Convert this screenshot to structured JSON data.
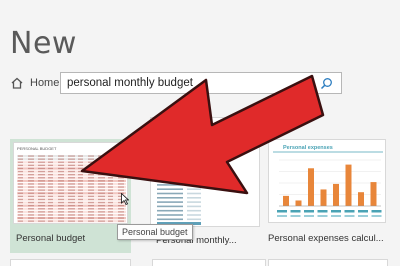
{
  "page": {
    "title": "New"
  },
  "nav": {
    "home_label": "Home",
    "search_value": "personal monthly budget",
    "home_icon": "home-icon",
    "search_icon": "search-icon"
  },
  "templates": [
    {
      "label": "Personal budget",
      "thumb_title": "PERSONAL BUDGET",
      "selected": true
    },
    {
      "label": "Personal monthly...",
      "selected": false
    },
    {
      "label": "Personal expenses calcul...",
      "thumb_title": "Personal expenses",
      "selected": false
    }
  ],
  "tooltip": {
    "text": "Personal budget"
  },
  "expenses_chart": {
    "bar_heights": [
      0.22,
      0.12,
      0.82,
      0.36,
      0.48,
      0.9,
      0.3,
      0.52
    ],
    "bar_color": "#e8863a"
  },
  "colors": {
    "arrow_fill": "#e02a2a",
    "arrow_stroke": "#3a1010",
    "selected_bg": "#cfe3d5",
    "accent_teal": "#4aa3b5"
  }
}
